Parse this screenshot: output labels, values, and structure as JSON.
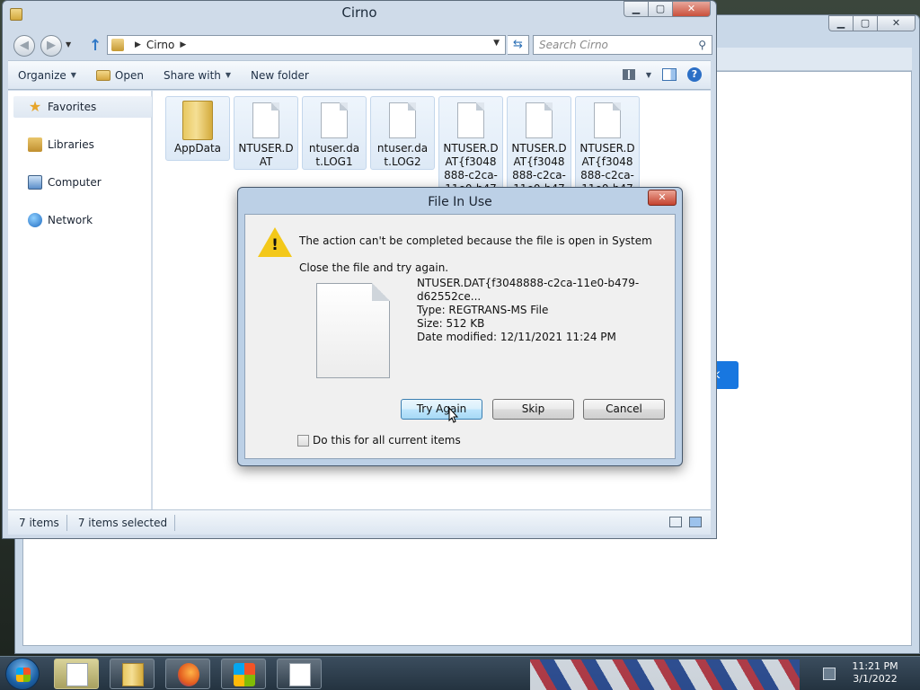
{
  "explorer": {
    "title": "Cirno",
    "address": {
      "crumb": "Cirno"
    },
    "search_placeholder": "Search Cirno",
    "toolbar": {
      "organize": "Organize",
      "open": "Open",
      "share_with": "Share with",
      "new_folder": "New folder"
    },
    "nav": {
      "favorites": "Favorites",
      "libraries": "Libraries",
      "computer": "Computer",
      "network": "Network"
    },
    "files": [
      {
        "name": "AppData",
        "type": "folder"
      },
      {
        "name": "NTUSER.DAT",
        "type": "file"
      },
      {
        "name": "ntuser.dat.LOG1",
        "type": "file"
      },
      {
        "name": "ntuser.dat.LOG2",
        "type": "file"
      },
      {
        "name": "NTUSER.DAT{f3048888-c2ca-11e0-b479-d62",
        "type": "file"
      },
      {
        "name": "NTUSER.DAT{f3048888-c2ca-11e0-b479-d62",
        "type": "file"
      },
      {
        "name": "NTUSER.DAT{f3048888-c2ca-11e0-b479-d62",
        "type": "file"
      }
    ],
    "status": {
      "items": "7 items",
      "selected": "7 items selected"
    }
  },
  "dialog": {
    "title": "File In Use",
    "close_glyph": "✕",
    "message": "The action can't be completed because the file is open in System",
    "hint": "Close the file and try again.",
    "file": {
      "name": "NTUSER.DAT{f3048888-c2ca-11e0-b479-d62552ce...",
      "type": "Type: REGTRANS-MS File",
      "size": "Size: 512 KB",
      "modified": "Date modified: 12/11/2021 11:24 PM"
    },
    "buttons": {
      "try_again": "Try Again",
      "skip": "Skip",
      "cancel": "Cancel"
    },
    "checkbox_label": "Do this for all current items"
  },
  "background_window": {
    "button_fragment": "k"
  },
  "taskbar": {
    "time": "11:21 PM",
    "date": "3/1/2022"
  },
  "icons": {
    "window_controls": [
      "minimize-icon",
      "maximize-icon",
      "close-icon"
    ],
    "nav": [
      "star-icon",
      "libraries-icon",
      "computer-icon",
      "network-icon"
    ],
    "dialog": [
      "warning-icon",
      "document-icon"
    ]
  },
  "colors": {
    "accent": "#1877e0",
    "title_close": "#c4432f",
    "warning": "#f3c81a",
    "default_button": "#bee6fd"
  }
}
